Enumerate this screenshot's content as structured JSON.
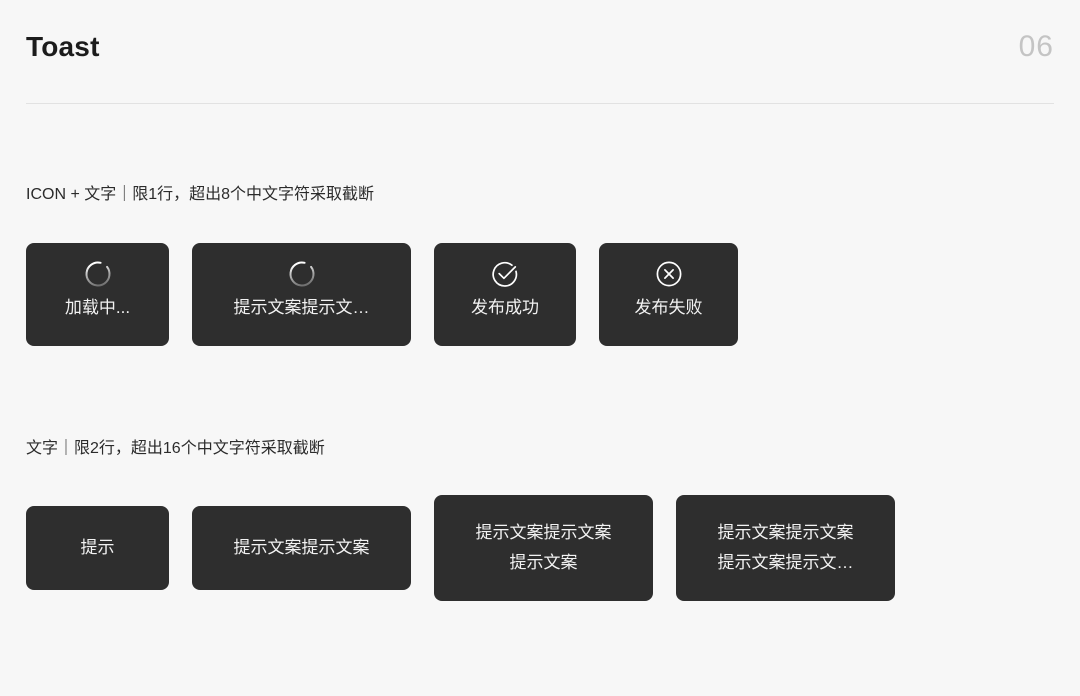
{
  "header": {
    "title": "Toast",
    "page_number": "06",
    "divider": true
  },
  "colors": {
    "page_background": "#f7f7f7",
    "toast_background": "#2e2e2e",
    "toast_text": "#f2f2f2",
    "title_text": "#1c1c1c",
    "page_number_text": "#c4c4c4",
    "divider": "#e2e2e2",
    "icon_stroke": "#ffffff"
  },
  "sections": [
    {
      "label": "ICON + 文字｜限1行，超出8个中文字符采取截断",
      "toasts": [
        {
          "icon": "loading-spinner-icon",
          "label": "加载中..."
        },
        {
          "icon": "loading-spinner-icon",
          "label": "提示文案提示文…"
        },
        {
          "icon": "check-circle-icon",
          "label": "发布成功"
        },
        {
          "icon": "close-circle-icon",
          "label": "发布失败"
        }
      ]
    },
    {
      "label": "文字｜限2行，超出16个中文字符采取截断",
      "toasts": [
        {
          "text": "提示"
        },
        {
          "text": "提示文案提示文案"
        },
        {
          "text": "提示文案提示文案\n提示文案"
        },
        {
          "text": "提示文案提示文案\n提示文案提示文…"
        }
      ]
    }
  ]
}
